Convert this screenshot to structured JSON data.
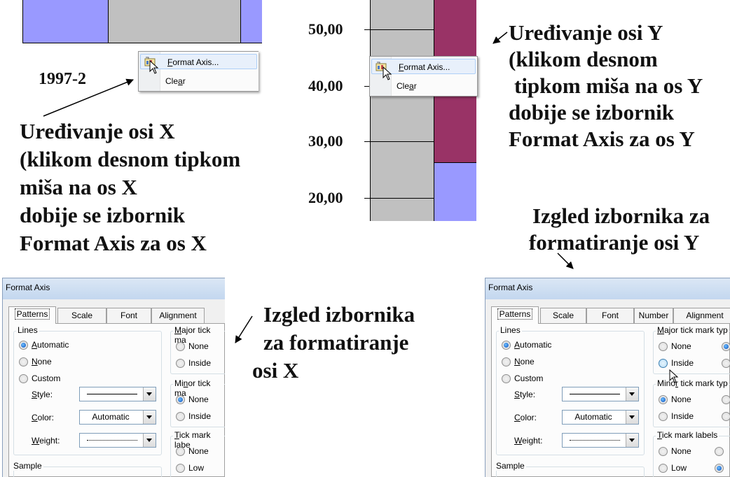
{
  "colors": {
    "chart_periwinkle": "#9999ff",
    "chart_grey": "#c0c0c0",
    "chart_maroon": "#993366",
    "chart_axis": "#000000",
    "dialog_bg": "#f0f0f0",
    "radio_selected": "#1d63c9"
  },
  "x_axis_chart": {
    "category_label": "1997-2"
  },
  "y_axis_chart": {
    "tick_labels": [
      "50,00",
      "40,00",
      "30,00",
      "20,00"
    ]
  },
  "context_menu": {
    "items": [
      {
        "label": "Format Axis...",
        "icon": "format-axis-icon"
      },
      {
        "label": "Clear"
      }
    ]
  },
  "annotations": {
    "x_axis_edit": [
      "Uređivanje osi X",
      "(klikom desnom tipkom",
      "miša na os X",
      "dobije se izbornik",
      "Format Axis za os X"
    ],
    "y_axis_edit": [
      "Uređivanje osi Y",
      "(klikom desnom",
      "tipkom miša na os Y",
      "dobije se izbornik",
      "Format Axis za os Y"
    ],
    "y_menu_look": [
      "Izgled izbornika za",
      "formatiranje osi Y"
    ],
    "x_menu_look": [
      "Izgled izbornika",
      "za formatiranje",
      "osi X"
    ]
  },
  "dialog_x": {
    "title": "Format Axis",
    "tabs": [
      "Patterns",
      "Scale",
      "Font",
      "Alignment"
    ],
    "lines_group": {
      "label": "Lines",
      "options": [
        "Automatic",
        "None",
        "Custom"
      ],
      "selected": "Automatic"
    },
    "style_label": "Style:",
    "color_label": "Color:",
    "color_value": "Automatic",
    "weight_label": "Weight:",
    "sample_label": "Sample",
    "major_label": "Major tick ma",
    "major_options": [
      "None",
      "Inside"
    ],
    "minor_label": "Minor tick ma",
    "minor_options": [
      "None",
      "Inside"
    ],
    "minor_selected": "None",
    "labels_label": "Tick mark labe",
    "labels_options": [
      "None",
      "Low"
    ]
  },
  "dialog_y": {
    "title": "Format Axis",
    "tabs": [
      "Patterns",
      "Scale",
      "Font",
      "Number",
      "Alignment"
    ],
    "lines_group": {
      "label": "Lines",
      "options": [
        "Automatic",
        "None",
        "Custom"
      ],
      "selected": "Automatic"
    },
    "style_label": "Style:",
    "color_label": "Color:",
    "color_value": "Automatic",
    "weight_label": "Weight:",
    "sample_label": "Sample",
    "major_label": "Major tick mark typ",
    "major_options": [
      "None",
      "Inside"
    ],
    "minor_label": "Minor tick mark typ",
    "minor_options": [
      "None",
      "Inside"
    ],
    "minor_selected": "None",
    "labels_label": "Tick mark labels",
    "labels_options": [
      "None",
      "Low"
    ],
    "labels_right_selected_row": "Low"
  }
}
